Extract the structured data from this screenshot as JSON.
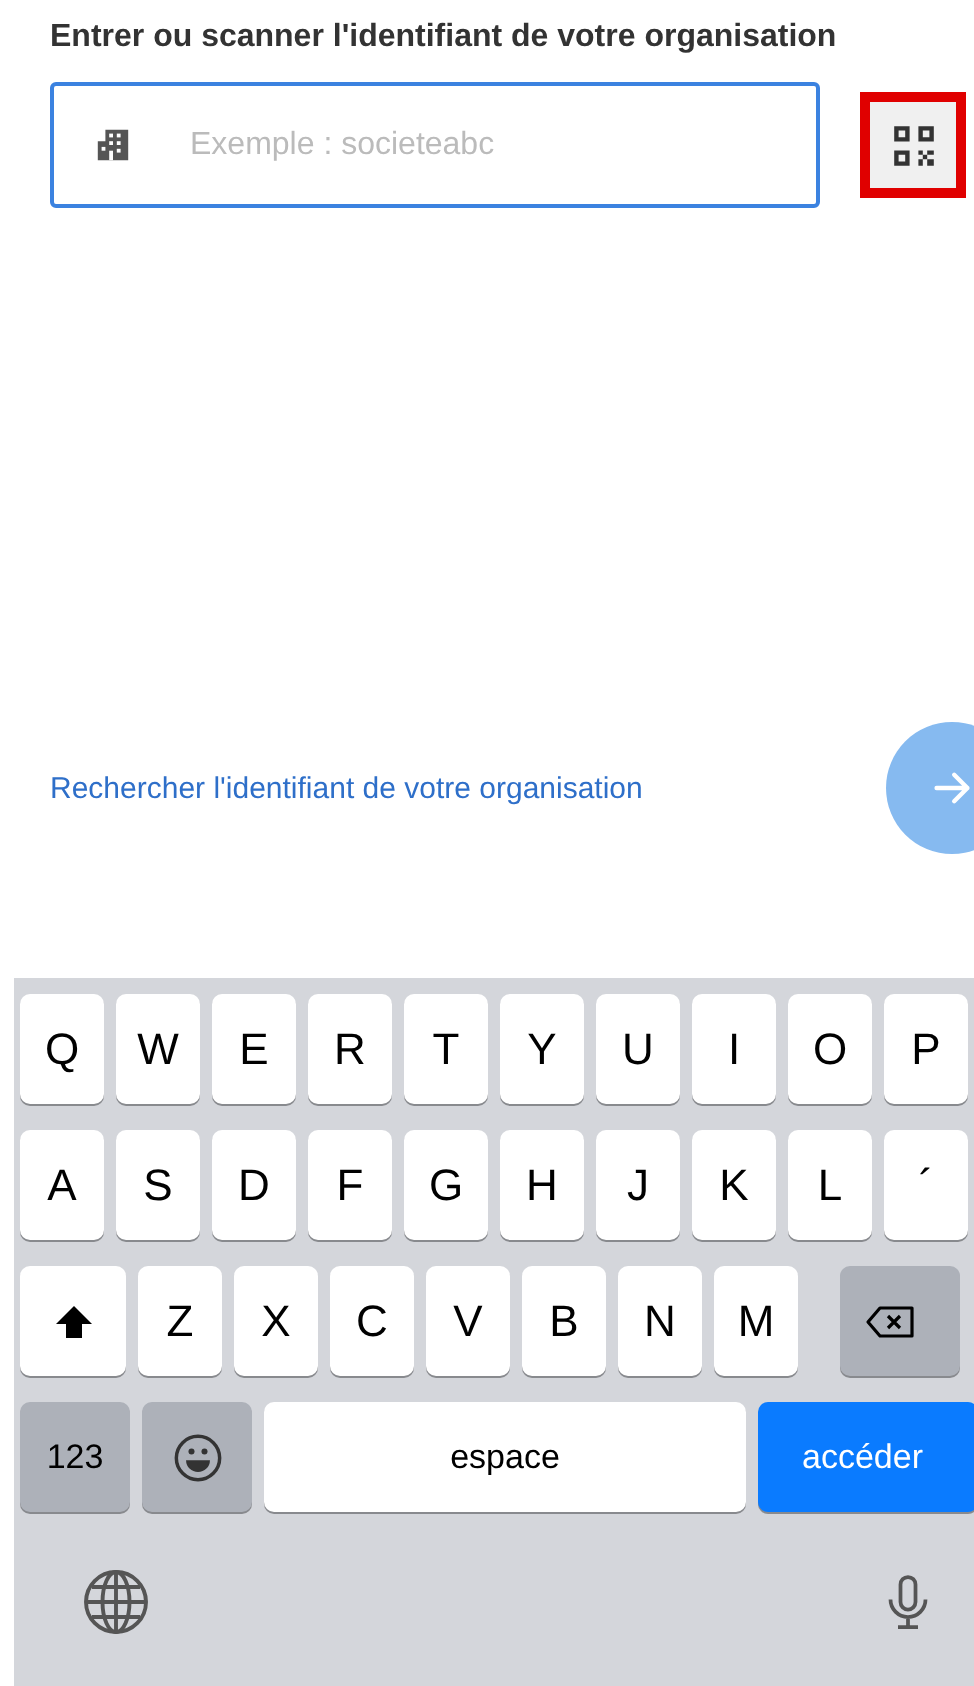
{
  "prompt": "Entrer ou scanner l'identifiant de votre organisation",
  "org_field": {
    "placeholder": "Exemple : societeabc"
  },
  "qr_button": {
    "highlighted": true
  },
  "search_link": "Rechercher l'identifiant de votre organisation",
  "next_button": {
    "disabled": true
  },
  "keyboard": {
    "rows": [
      {
        "keys": [
          {
            "kind": "letter",
            "label": "Q"
          },
          {
            "kind": "letter",
            "label": "W"
          },
          {
            "kind": "letter",
            "label": "E"
          },
          {
            "kind": "letter",
            "label": "R"
          },
          {
            "kind": "letter",
            "label": "T"
          },
          {
            "kind": "letter",
            "label": "Y"
          },
          {
            "kind": "letter",
            "label": "U"
          },
          {
            "kind": "letter",
            "label": "I"
          },
          {
            "kind": "letter",
            "label": "O"
          },
          {
            "kind": "letter",
            "label": "P"
          }
        ]
      },
      {
        "keys": [
          {
            "kind": "letter",
            "label": "A"
          },
          {
            "kind": "letter",
            "label": "S"
          },
          {
            "kind": "letter",
            "label": "D"
          },
          {
            "kind": "letter",
            "label": "F"
          },
          {
            "kind": "letter",
            "label": "G"
          },
          {
            "kind": "letter",
            "label": "H"
          },
          {
            "kind": "letter",
            "label": "J"
          },
          {
            "kind": "letter",
            "label": "K"
          },
          {
            "kind": "letter",
            "label": "L"
          },
          {
            "kind": "letter",
            "label": "´"
          }
        ]
      },
      {
        "keys": [
          {
            "kind": "shift"
          },
          {
            "kind": "letter",
            "label": "Z"
          },
          {
            "kind": "letter",
            "label": "X"
          },
          {
            "kind": "letter",
            "label": "C"
          },
          {
            "kind": "letter",
            "label": "V"
          },
          {
            "kind": "letter",
            "label": "B"
          },
          {
            "kind": "letter",
            "label": "N"
          },
          {
            "kind": "letter",
            "label": "M"
          },
          {
            "kind": "delete"
          }
        ]
      },
      {
        "keys": [
          {
            "kind": "mode",
            "label": "123"
          },
          {
            "kind": "emoji"
          },
          {
            "kind": "space",
            "label": "espace"
          },
          {
            "kind": "go",
            "label": "accéder"
          }
        ]
      }
    ]
  }
}
